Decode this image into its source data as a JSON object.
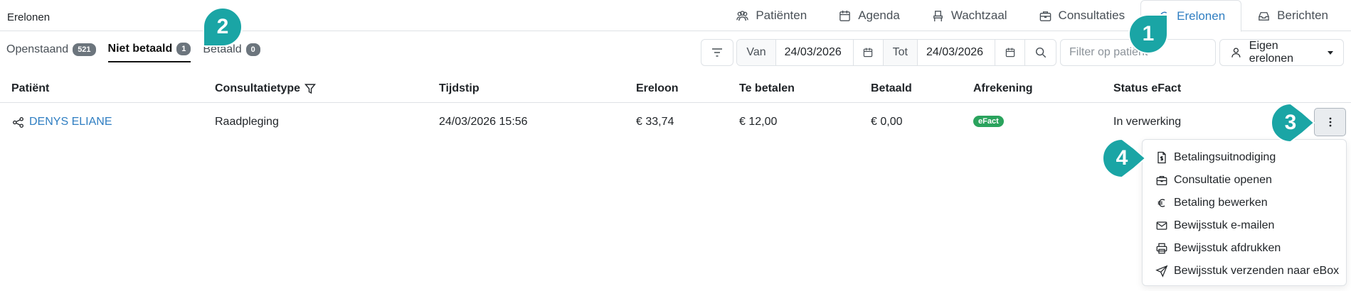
{
  "page_title": "Erelonen",
  "nav": [
    {
      "label": "Patiënten",
      "icon": "users-icon"
    },
    {
      "label": "Agenda",
      "icon": "calendar-icon"
    },
    {
      "label": "Wachtzaal",
      "icon": "chair-icon"
    },
    {
      "label": "Consultaties",
      "icon": "briefcase-icon"
    },
    {
      "label": "Erelonen",
      "icon": "euro-icon",
      "active": true
    },
    {
      "label": "Berichten",
      "icon": "inbox-icon"
    }
  ],
  "subtabs": [
    {
      "label": "Openstaand",
      "count": "521"
    },
    {
      "label": "Niet betaald",
      "count": "1",
      "active": true
    },
    {
      "label": "Betaald",
      "count": "0"
    }
  ],
  "filters": {
    "from_label": "Van",
    "from_date": "24/03/2026",
    "to_label": "Tot",
    "to_date": "24/03/2026",
    "patient_placeholder": "Filter op patiënt",
    "own_fees_label": "Eigen erelonen"
  },
  "table": {
    "columns": [
      "Patiënt",
      "Consultatietype",
      "Tijdstip",
      "Ereloon",
      "Te betalen",
      "Betaald",
      "Afrekening",
      "Status eFact"
    ],
    "rows": [
      {
        "patient": "DENYS ELIANE",
        "consultation_type": "Raadpleging",
        "time": "24/03/2026 15:56",
        "fee": "€ 33,74",
        "to_pay": "€ 12,00",
        "paid": "€ 0,00",
        "settlement": "eFact",
        "status": "In verwerking"
      }
    ]
  },
  "row_menu": [
    {
      "label": "Betalingsuitnodiging",
      "icon": "invoice-dollar-icon"
    },
    {
      "label": "Consultatie openen",
      "icon": "briefcase-icon"
    },
    {
      "label": "Betaling bewerken",
      "icon": "euro-icon"
    },
    {
      "label": "Bewijsstuk e-mailen",
      "icon": "envelope-icon"
    },
    {
      "label": "Bewijsstuk afdrukken",
      "icon": "printer-icon"
    },
    {
      "label": "Bewijsstuk verzenden naar eBox",
      "icon": "send-icon"
    }
  ],
  "callouts": [
    "1",
    "2",
    "3",
    "4"
  ],
  "colors": {
    "accent": "#2f7ec2",
    "callout": "#1aa5a5",
    "badge": "#6c757d",
    "efact": "#2aa35d"
  }
}
